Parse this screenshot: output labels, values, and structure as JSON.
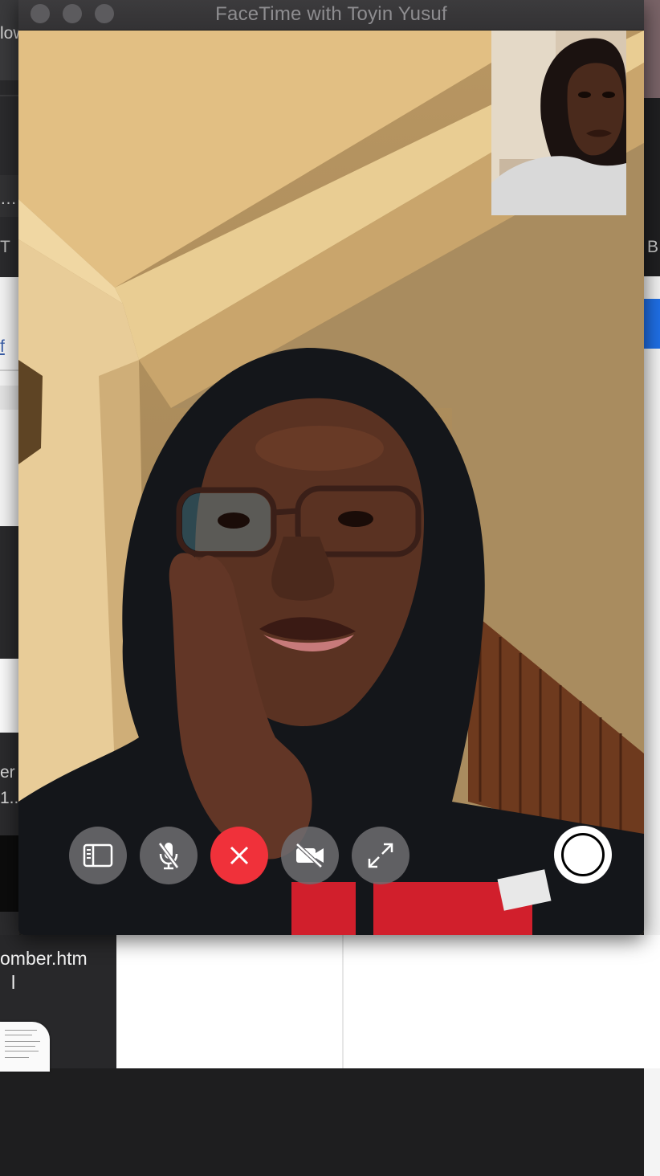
{
  "window": {
    "title": "FaceTime with Toyin Yusuf"
  },
  "background": {
    "left_fragments": [
      "low",
      "…",
      "T",
      "f",
      "er",
      "1.."
    ],
    "right_fragments": [
      "B"
    ],
    "file": {
      "name_line1": "omber.htm",
      "name_line2": "l"
    }
  },
  "controls": {
    "sidebar_icon": "sidebar-icon",
    "mute_icon": "microphone-slash-icon",
    "end_call_icon": "close-icon",
    "camera_icon": "video-camera-slash-icon",
    "fullscreen_icon": "expand-arrows-icon",
    "record_icon": "record-icon"
  },
  "colors": {
    "end_call": "#f0313a",
    "control_bg": "#6e6c70",
    "titlebar": "#3a393b"
  }
}
